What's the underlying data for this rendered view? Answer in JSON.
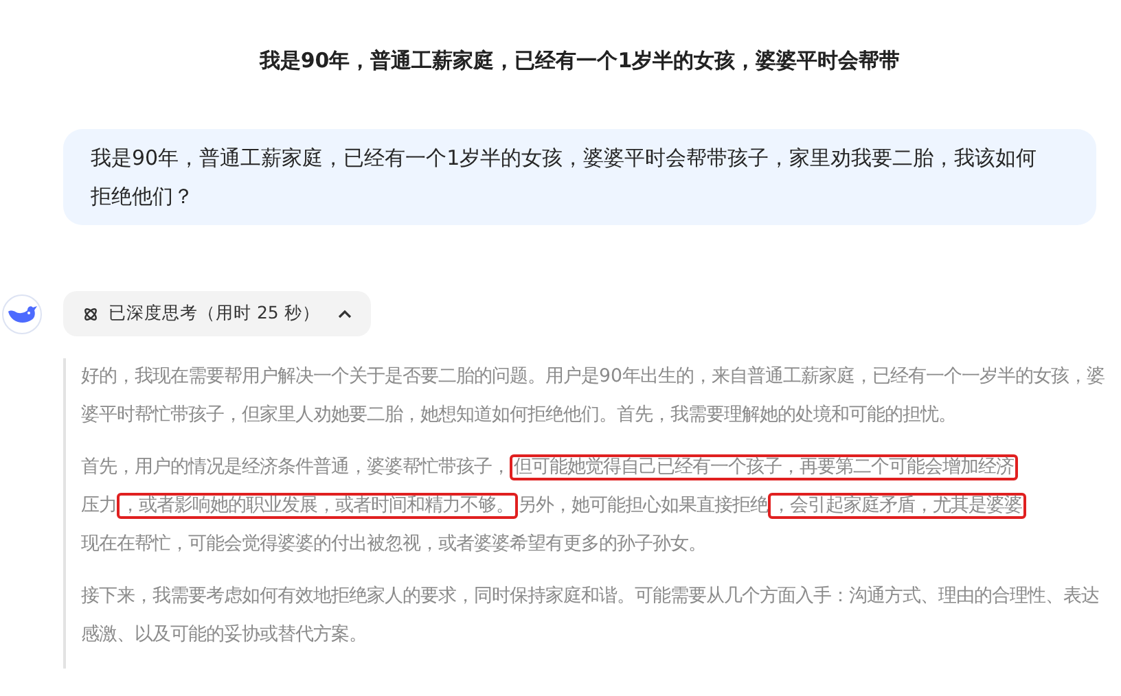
{
  "chat_title": "我是90年，普通工薪家庭，已经有一个1岁半的女孩，婆婆平时会帮带",
  "user_message": "我是90年，普通工薪家庭，已经有一个1岁半的女孩，婆婆平时会帮带孩子，家里劝我要二胎，我该如何拒绝他们？",
  "thinking": {
    "label": "已深度思考（用时 25 秒）",
    "expanded": true,
    "paragraphs": [
      {
        "segments": [
          {
            "text": "好的，我现在需要帮用户解决一个关于是否要二胎的问题。用户是90年出生的，来自普通工薪家庭，已经有一个一岁半的女孩，婆婆平时帮忙带孩子，但家里人劝她要二胎，她想知道如何拒绝他们。首先，我需要理解她的处境和可能的担忧。",
            "highlighted": false
          }
        ]
      },
      {
        "segments": [
          {
            "text": "首先，用户的情况是经济条件普通，婆婆帮忙带孩子，",
            "highlighted": false
          },
          {
            "text": "但可能她觉得自己已经有一个孩子，再要第二个可能会增加经济",
            "highlighted": true
          },
          {
            "text": "压力",
            "highlighted": false
          },
          {
            "text": "，或者影响她的职业发展，或者时间和精力不够。",
            "highlighted": true
          },
          {
            "text": "另外，她可能担心如果直接拒绝",
            "highlighted": false
          },
          {
            "text": "，会引起家庭矛盾，尤其是婆婆",
            "highlighted": true
          },
          {
            "text": "现在在帮忙，可能会觉得婆婆的付出被忽视，或者婆婆希望有更多的孙子孙女。",
            "highlighted": false
          }
        ]
      },
      {
        "segments": [
          {
            "text": "接下来，我需要考虑如何有效地拒绝家人的要求，同时保持家庭和谐。可能需要从几个方面入手：沟通方式、理由的合理性、表达感激、以及可能的妥协或替代方案。",
            "highlighted": false
          }
        ]
      }
    ]
  }
}
